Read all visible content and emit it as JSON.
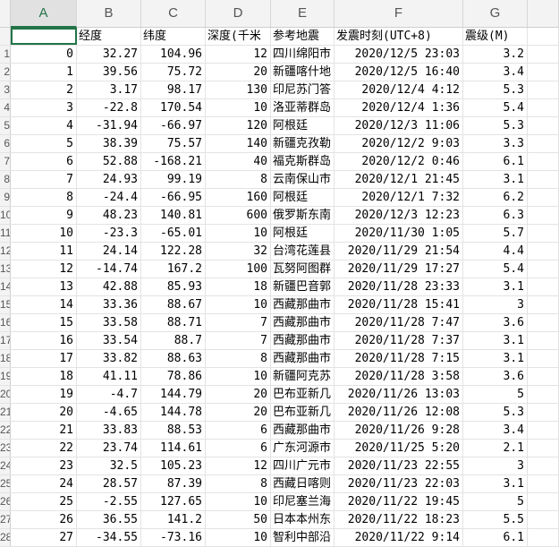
{
  "columns": [
    "A",
    "B",
    "C",
    "D",
    "E",
    "F",
    "G"
  ],
  "header": [
    "",
    "经度",
    "纬度",
    "深度(千米",
    "参考地震",
    "发震时刻(UTC+8)",
    "震级(M)"
  ],
  "rows": [
    {
      "n": "1",
      "c": [
        "0",
        "32.27",
        "104.96",
        "12",
        "四川绵阳市",
        "2020/12/5 23:03",
        "3.2"
      ]
    },
    {
      "n": "2",
      "c": [
        "1",
        "39.56",
        "75.72",
        "20",
        "新疆喀什地",
        "2020/12/5 16:40",
        "3.4"
      ]
    },
    {
      "n": "3",
      "c": [
        "2",
        "3.17",
        "98.17",
        "130",
        "印尼苏门答",
        "2020/12/4 4:12",
        "5.3"
      ]
    },
    {
      "n": "4",
      "c": [
        "3",
        "-22.8",
        "170.54",
        "10",
        "洛亚蒂群岛",
        "2020/12/4 1:36",
        "5.4"
      ]
    },
    {
      "n": "5",
      "c": [
        "4",
        "-31.94",
        "-66.97",
        "120",
        "阿根廷",
        "2020/12/3 11:06",
        "5.3"
      ]
    },
    {
      "n": "6",
      "c": [
        "5",
        "38.39",
        "75.57",
        "140",
        "新疆克孜勒",
        "2020/12/2 9:03",
        "3.3"
      ]
    },
    {
      "n": "7",
      "c": [
        "6",
        "52.88",
        "-168.21",
        "40",
        "福克斯群岛",
        "2020/12/2 0:46",
        "6.1"
      ]
    },
    {
      "n": "8",
      "c": [
        "7",
        "24.93",
        "99.19",
        "8",
        "云南保山市",
        "2020/12/1 21:45",
        "3.1"
      ]
    },
    {
      "n": "9",
      "c": [
        "8",
        "-24.4",
        "-66.95",
        "160",
        "阿根廷",
        "2020/12/1 7:32",
        "6.2"
      ]
    },
    {
      "n": "10",
      "c": [
        "9",
        "48.23",
        "140.81",
        "600",
        "俄罗斯东南",
        "2020/12/3 12:23",
        "6.3"
      ]
    },
    {
      "n": "11",
      "c": [
        "10",
        "-23.3",
        "-65.01",
        "10",
        "阿根廷",
        "2020/11/30 1:05",
        "5.7"
      ]
    },
    {
      "n": "12",
      "c": [
        "11",
        "24.14",
        "122.28",
        "32",
        "台湾花莲县",
        "2020/11/29 21:54",
        "4.4"
      ]
    },
    {
      "n": "13",
      "c": [
        "12",
        "-14.74",
        "167.2",
        "100",
        "瓦努阿图群",
        "2020/11/29 17:27",
        "5.4"
      ]
    },
    {
      "n": "14",
      "c": [
        "13",
        "42.88",
        "85.93",
        "18",
        "新疆巴音郭",
        "2020/11/28 23:33",
        "3.1"
      ]
    },
    {
      "n": "15",
      "c": [
        "14",
        "33.36",
        "88.67",
        "10",
        "西藏那曲市",
        "2020/11/28 15:41",
        "3"
      ]
    },
    {
      "n": "16",
      "c": [
        "15",
        "33.58",
        "88.71",
        "7",
        "西藏那曲市",
        "2020/11/28 7:47",
        "3.6"
      ]
    },
    {
      "n": "17",
      "c": [
        "16",
        "33.54",
        "88.7",
        "7",
        "西藏那曲市",
        "2020/11/28 7:37",
        "3.1"
      ]
    },
    {
      "n": "18",
      "c": [
        "17",
        "33.82",
        "88.63",
        "8",
        "西藏那曲市",
        "2020/11/28 7:15",
        "3.1"
      ]
    },
    {
      "n": "19",
      "c": [
        "18",
        "41.11",
        "78.86",
        "10",
        "新疆阿克苏",
        "2020/11/28 3:58",
        "3.6"
      ]
    },
    {
      "n": "20",
      "c": [
        "19",
        "-4.7",
        "144.79",
        "20",
        "巴布亚新几",
        "2020/11/26 13:03",
        "5"
      ]
    },
    {
      "n": "21",
      "c": [
        "20",
        "-4.65",
        "144.78",
        "20",
        "巴布亚新几",
        "2020/11/26 12:08",
        "5.3"
      ]
    },
    {
      "n": "22",
      "c": [
        "21",
        "33.83",
        "88.53",
        "6",
        "西藏那曲市",
        "2020/11/26 9:28",
        "3.4"
      ]
    },
    {
      "n": "23",
      "c": [
        "22",
        "23.74",
        "114.61",
        "6",
        "广东河源市",
        "2020/11/25 5:20",
        "2.1"
      ]
    },
    {
      "n": "24",
      "c": [
        "23",
        "32.5",
        "105.23",
        "12",
        "四川广元市",
        "2020/11/23 22:55",
        "3"
      ]
    },
    {
      "n": "25",
      "c": [
        "24",
        "28.57",
        "87.39",
        "8",
        "西藏日喀则",
        "2020/11/23 22:03",
        "3.1"
      ]
    },
    {
      "n": "26",
      "c": [
        "25",
        "-2.55",
        "127.65",
        "10",
        "印尼塞兰海",
        "2020/11/22 19:45",
        "5"
      ]
    },
    {
      "n": "27",
      "c": [
        "26",
        "36.55",
        "141.2",
        "50",
        "日本本州东",
        "2020/11/22 18:23",
        "5.5"
      ]
    },
    {
      "n": "28",
      "c": [
        "27",
        "-34.55",
        "-73.16",
        "10",
        "智利中部沿",
        "2020/11/22 9:14",
        "6.1"
      ]
    }
  ]
}
